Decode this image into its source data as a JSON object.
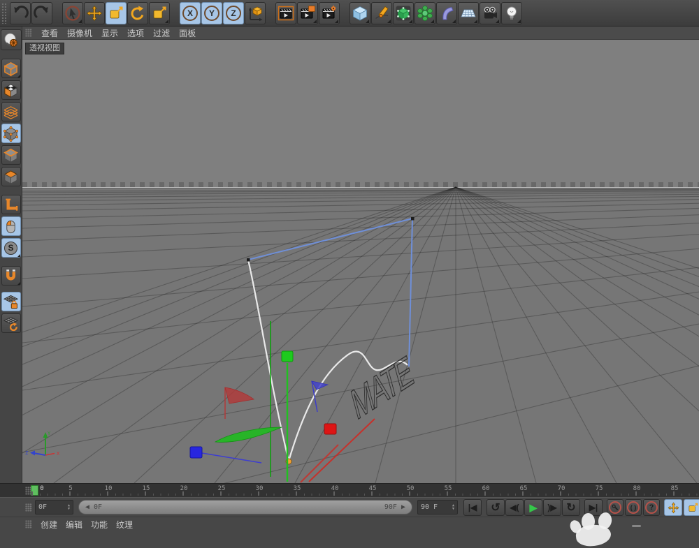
{
  "toolbar": {
    "axis_lock": [
      "X",
      "Y",
      "Z"
    ]
  },
  "menu_bar": {
    "items": [
      "查看",
      "摄像机",
      "显示",
      "选项",
      "过滤",
      "面板"
    ]
  },
  "viewport": {
    "label": "透视视图",
    "axis_gizmo": {
      "x": "X",
      "y": "Y",
      "z": "Z"
    }
  },
  "scene": {
    "text_label": "MATE"
  },
  "timeline": {
    "labels": [
      "0",
      "5",
      "10",
      "15",
      "20",
      "25",
      "30",
      "35",
      "40",
      "45",
      "50",
      "55",
      "60",
      "65",
      "70",
      "75",
      "80",
      "85"
    ],
    "playhead_frame": "0"
  },
  "transport": {
    "current_frame": "0F",
    "range_start_label": "◀ 0F",
    "range_end_label": "90F ▶",
    "end_frame": "90 F",
    "buttons": {
      "goto_start": "|◀",
      "prev_key": "↺",
      "prev_frame": "◀(",
      "play": "▶",
      "next_frame": ")▶",
      "next_key": "↻",
      "goto_end": "▶|",
      "parens": "( )",
      "help": "?"
    }
  },
  "bottom_menu": {
    "items": [
      "创建",
      "编辑",
      "功能",
      "纹理"
    ]
  },
  "icons": {
    "snap_letter": "S",
    "step_up": "▲",
    "step_down": "▼"
  },
  "colors": {
    "accent_orange": "#f2a71f",
    "selection_blue": "#a7c6e7",
    "play_green": "#35c74a",
    "record_red": "#b5524a",
    "playhead_green": "#5fbf5f",
    "spline_white": "#e9e9e9",
    "spline_blue": "#6f8fd8",
    "marker_green": "#1ecb1e",
    "marker_red": "#dd1515",
    "marker_blue": "#2726e0",
    "point_orange": "#f2a233"
  }
}
